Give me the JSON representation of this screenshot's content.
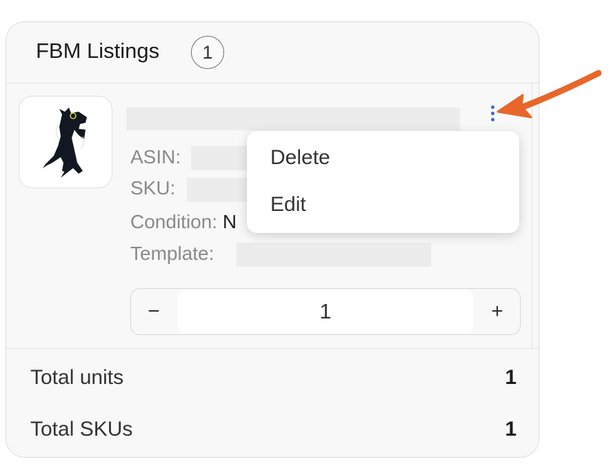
{
  "panel": {
    "title": "FBM Listings",
    "count": "1"
  },
  "listing": {
    "thumbnail_icon": "plush-dragon-product-image",
    "asin_label": "ASIN:",
    "sku_label": "SKU:",
    "condition_label": "Condition:",
    "condition_value_visible": "N",
    "template_label": "Template:"
  },
  "quantity": {
    "minus": "−",
    "value": "1",
    "plus": "+"
  },
  "menu": {
    "items": [
      "Delete",
      "Edit"
    ]
  },
  "totals": {
    "units_label": "Total units",
    "units_value": "1",
    "skus_label": "Total SKUs",
    "skus_value": "1"
  },
  "colors": {
    "kebab": "#3a66d6",
    "annotation_arrow": "#e8662a"
  }
}
